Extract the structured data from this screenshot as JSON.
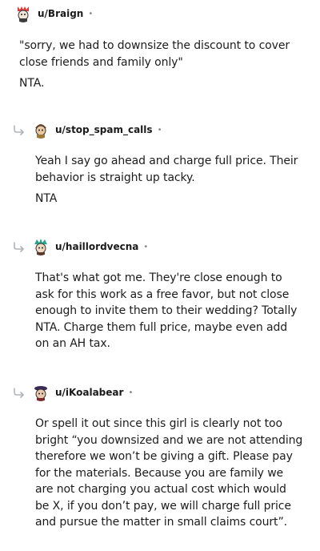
{
  "comments": [
    {
      "username": "u/Braign",
      "dot": "•",
      "paragraphs": [
        "\"sorry, we had to downsize the discount to cover close friends and family only\"",
        "NTA."
      ]
    },
    {
      "username": "u/stop_spam_calls",
      "dot": "•",
      "paragraphs": [
        "Yeah I say go ahead and charge full price. Their behavior is straight up tacky.",
        "NTA"
      ]
    },
    {
      "username": "u/haillordvecna",
      "dot": "•",
      "paragraphs": [
        "That's what got me. They're close enough to ask for this work as a free favor, but not close enough to invite them to their wedding? Totally NTA. Charge them full price, maybe even add on an AH tax."
      ]
    },
    {
      "username": "u/iKoalabear",
      "dot": "•",
      "paragraphs": [
        "Or spell it out since this girl is clearly not too bright “you downsized and we are not attending therefore we won’t be giving a gift. Please pay for the materials. Because you are family we are not charging you actual cost which would be X, if you don’t pay, we will charge full price and pursue the matter in small claims court”."
      ]
    }
  ]
}
